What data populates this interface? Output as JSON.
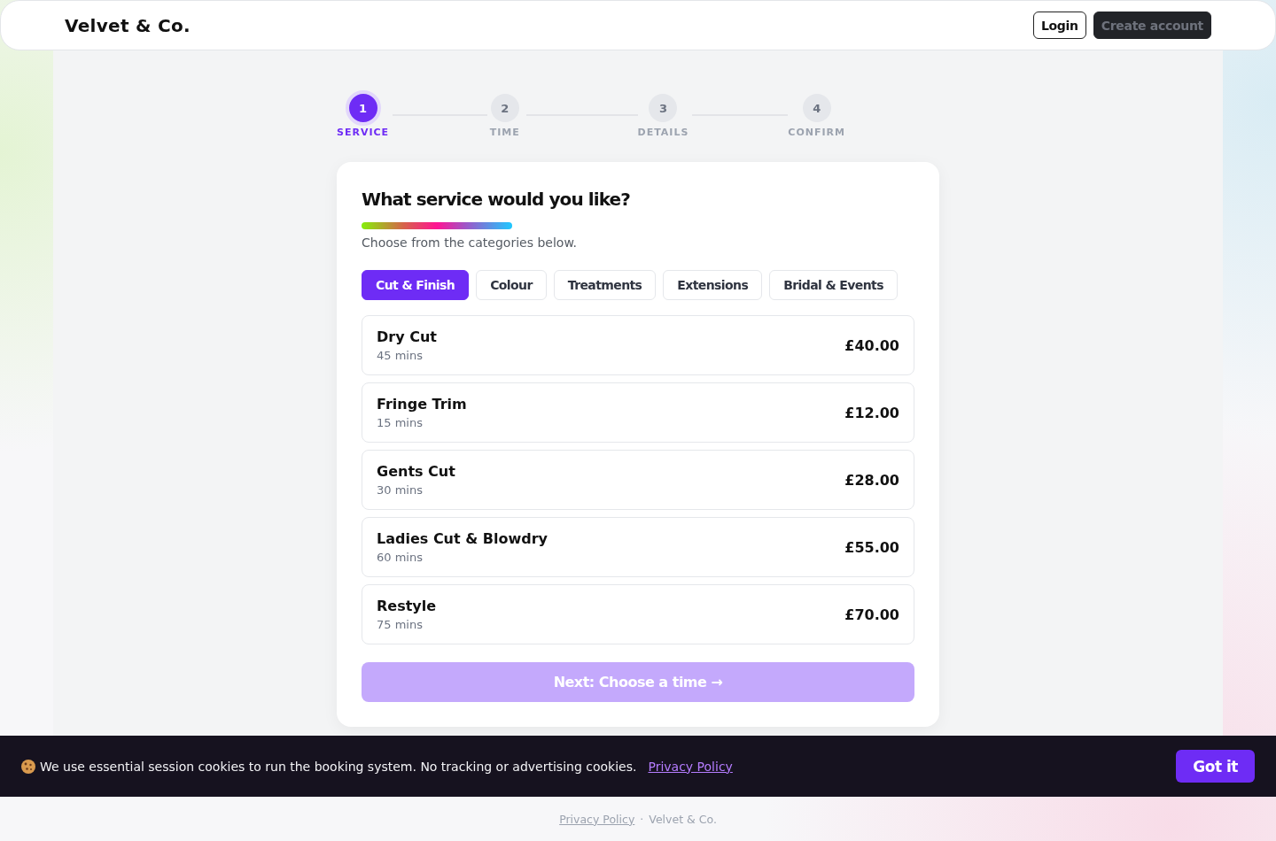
{
  "header": {
    "logo": "Velvet & Co.",
    "buttons": [
      {
        "label": "Login",
        "kind": "outline"
      },
      {
        "label": "Create account",
        "kind": "solid"
      }
    ]
  },
  "stepper": {
    "steps": [
      {
        "number": "1",
        "label": "SERVICE",
        "selected": true
      },
      {
        "number": "2",
        "label": "TIME",
        "selected": false
      },
      {
        "number": "3",
        "label": "DETAILS",
        "selected": false
      },
      {
        "number": "4",
        "label": "CONFIRM",
        "selected": false
      }
    ]
  },
  "card": {
    "title": "What service would you like?",
    "subtitle": "Choose from the categories below.",
    "tabs": [
      {
        "label": "Cut & Finish",
        "selected": true
      },
      {
        "label": "Colour",
        "selected": false
      },
      {
        "label": "Treatments",
        "selected": false
      },
      {
        "label": "Extensions",
        "selected": false
      },
      {
        "label": "Bridal & Events",
        "selected": false
      }
    ],
    "services": [
      {
        "name": "Dry Cut",
        "duration": "45 mins",
        "price": "£40.00"
      },
      {
        "name": "Fringe Trim",
        "duration": "15 mins",
        "price": "£12.00"
      },
      {
        "name": "Gents Cut",
        "duration": "30 mins",
        "price": "£28.00"
      },
      {
        "name": "Ladies Cut & Blowdry",
        "duration": "60 mins",
        "price": "£55.00"
      },
      {
        "name": "Restyle",
        "duration": "75 mins",
        "price": "£70.00"
      }
    ],
    "next_button": {
      "label": "Next: Choose a time →",
      "disabled": true
    }
  },
  "cookie_banner": {
    "text": "We use essential session cookies to run the booking system. No tracking or advertising cookies.",
    "link": "Privacy Policy",
    "button": "Got it"
  },
  "footer": {
    "link": "Privacy Policy",
    "separator": "·",
    "text": "Velvet & Co."
  }
}
